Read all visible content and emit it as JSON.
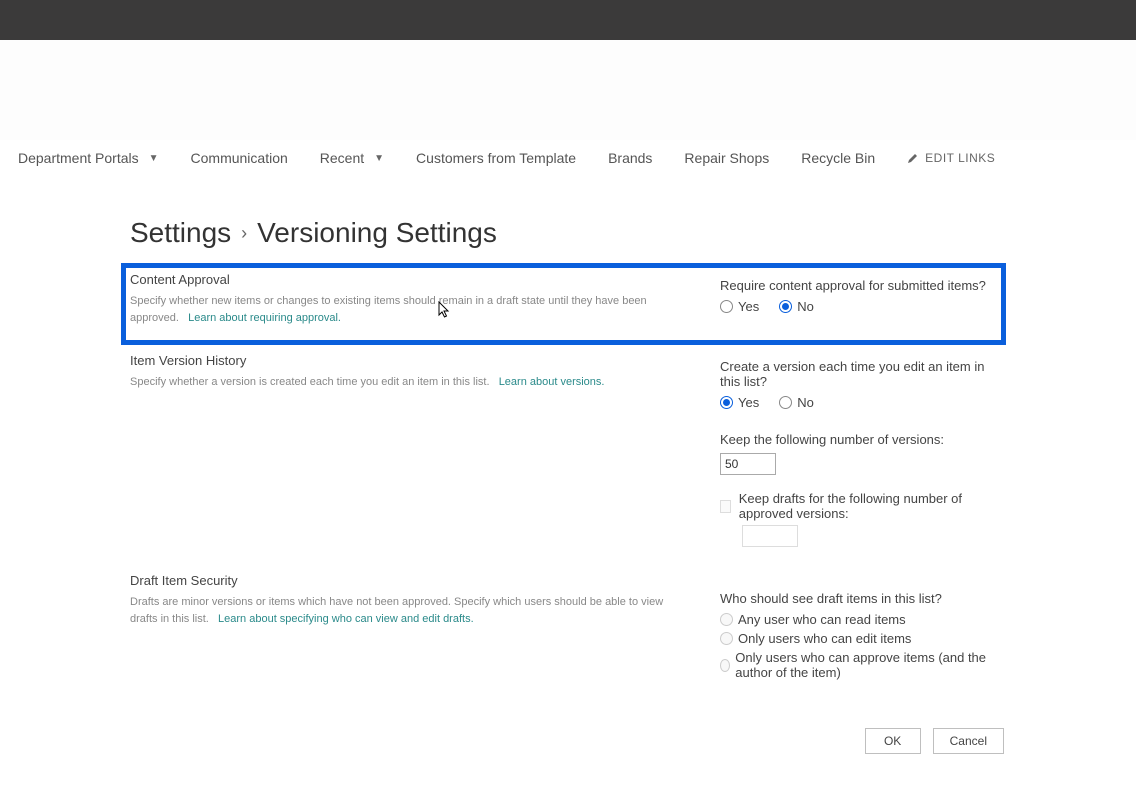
{
  "nav": {
    "items": [
      {
        "label": "Department Portals",
        "hasDropdown": true
      },
      {
        "label": "Communication",
        "hasDropdown": false
      },
      {
        "label": "Recent",
        "hasDropdown": true
      },
      {
        "label": "Customers from Template",
        "hasDropdown": false
      },
      {
        "label": "Brands",
        "hasDropdown": false
      },
      {
        "label": "Repair Shops",
        "hasDropdown": false
      },
      {
        "label": "Recycle Bin",
        "hasDropdown": false
      }
    ],
    "editLinks": "EDIT LINKS"
  },
  "breadcrumb": {
    "root": "Settings",
    "page": "Versioning Settings"
  },
  "sections": {
    "contentApproval": {
      "title": "Content Approval",
      "desc": "Specify whether new items or changes to existing items should remain in a draft state until they have been approved.",
      "learnLink": "Learn about requiring approval.",
      "question": "Require content approval for submitted items?",
      "yes": "Yes",
      "no": "No"
    },
    "versionHistory": {
      "title": "Item Version History",
      "desc": "Specify whether a version is created each time you edit an item in this list.",
      "learnLink": "Learn about versions.",
      "q1": "Create a version each time you edit an item in this list?",
      "yes": "Yes",
      "no": "No",
      "keepVersionsLabel": "Keep the following number of versions:",
      "keepVersionsValue": "50",
      "keepDraftsLabel": "Keep drafts for the following number of approved versions:",
      "keepDraftsValue": ""
    },
    "draftSecurity": {
      "title": "Draft Item Security",
      "desc": "Drafts are minor versions or items which have not been approved. Specify which users should be able to view drafts in this list.",
      "learnLink": "Learn about specifying who can view and edit drafts.",
      "question": "Who should see draft items in this list?",
      "opt1": "Any user who can read items",
      "opt2": "Only users who can edit items",
      "opt3": "Only users who can approve items (and the author of the item)"
    }
  },
  "buttons": {
    "ok": "OK",
    "cancel": "Cancel"
  }
}
